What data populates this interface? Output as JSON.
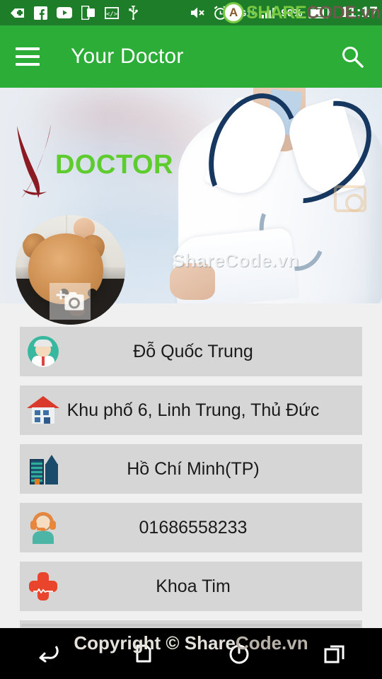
{
  "statusbar": {
    "left_icons": [
      {
        "name": "badge-plus-icon",
        "label": "badge-plus"
      },
      {
        "name": "facebook-icon",
        "label": "Facebook"
      },
      {
        "name": "youtube-icon",
        "label": "YouTube"
      },
      {
        "name": "screen-copy-icon",
        "label": "screen-copy"
      },
      {
        "name": "developer-code-icon",
        "label": "</>"
      },
      {
        "name": "usb-icon",
        "label": "USB"
      }
    ],
    "right_icons": [
      {
        "name": "volume-mute-icon",
        "label": "muted"
      },
      {
        "name": "alarm-clock-icon",
        "label": "alarm"
      },
      {
        "name": "network-3g-icon",
        "label": "3G"
      },
      {
        "name": "signal-bars-icon",
        "label": "signal"
      },
      {
        "name": "battery-icon",
        "label": "battery"
      }
    ],
    "network_label": "3G",
    "battery_percent": "90%",
    "time": "11:17",
    "watermark": {
      "mark": "A",
      "part1": "SHARE",
      "part2": "CODE",
      "part3": ".vn"
    }
  },
  "appbar": {
    "menu_icon": "hamburger-menu-icon",
    "title": "Your Doctor",
    "search_icon": "search-icon"
  },
  "banner": {
    "logo_letter": "Y",
    "logo_text": "DOCTOR",
    "watermark": "ShareCode.vn",
    "alt": "doctor in white coat with stethoscope"
  },
  "avatar": {
    "alt": "puppy profile photo",
    "overlay_icon": "add-photo-camera-icon"
  },
  "profile_rows": [
    {
      "icon": "doctor-icon",
      "value": "Đỗ Quốc Trung"
    },
    {
      "icon": "home-icon",
      "value": "Khu phố 6, Linh Trung, Thủ Đức"
    },
    {
      "icon": "city-icon",
      "value": "Hồ Chí Minh(TP)"
    },
    {
      "icon": "support-agent-icon",
      "value": "01686558233"
    },
    {
      "icon": "medical-cross-icon",
      "value": "Khoa Tim"
    }
  ],
  "navbar": {
    "buttons": [
      {
        "name": "back-button",
        "label": "Back"
      },
      {
        "name": "home-button",
        "label": "Home"
      },
      {
        "name": "power-button",
        "label": "Power"
      },
      {
        "name": "recents-button",
        "label": "Recents"
      }
    ],
    "watermark_part1": "Copyright © Share",
    "watermark_part2": "Code.vn"
  },
  "colors": {
    "accent_green": "#2bad37",
    "statusbar_green": "#1e7d28",
    "row_gray": "#d6d6d6",
    "page_bg": "#f0f0f0",
    "logo_green": "#5ecc2e",
    "logo_red": "#8c1a22"
  }
}
